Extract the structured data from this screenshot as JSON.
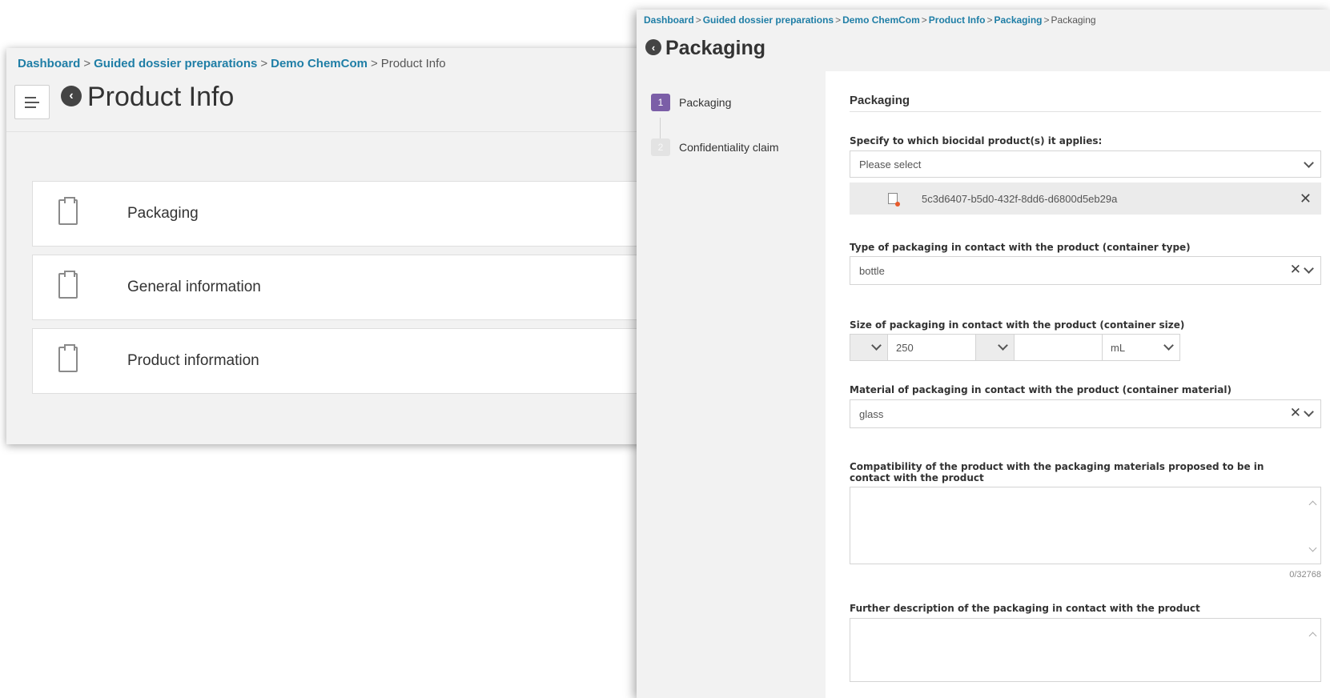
{
  "left_window": {
    "breadcrumb": [
      "Dashboard",
      "Guided dossier preparations",
      "Demo ChemCom",
      "Product Info"
    ],
    "separator": ">",
    "title": "Product Info",
    "cards": [
      {
        "label": "Packaging"
      },
      {
        "label": "General information"
      },
      {
        "label": "Product information"
      }
    ]
  },
  "right_window": {
    "breadcrumb": [
      "Dashboard",
      "Guided dossier preparations",
      "Demo ChemCom",
      "Product Info",
      "Packaging",
      "Packaging"
    ],
    "title": "Packaging",
    "steps": [
      {
        "number": "1",
        "label": "Packaging",
        "active": true
      },
      {
        "number": "2",
        "label": "Confidentiality claim",
        "active": false
      }
    ],
    "form": {
      "section_title": "Packaging",
      "biocidal_label": "Specify to which biocidal product(s) it applies:",
      "biocidal_placeholder": "Please select",
      "selected_product_id": "5c3d6407-b5d0-432f-8dd6-d6800d5eb29a",
      "container_type_label": "Type of packaging in contact with the product (container type)",
      "container_type_value": "bottle",
      "container_size_label": "Size of packaging in contact with the product (container size)",
      "container_size_value": "250",
      "container_size_upper": "",
      "container_size_unit": "mL",
      "container_material_label": "Material of packaging in contact with the product (container material)",
      "container_material_value": "glass",
      "compatibility_label": "Compatibility of the product with the packaging materials proposed to be in contact with the product",
      "compatibility_counter": "0/32768",
      "further_description_label": "Further description of the packaging in contact with the product"
    }
  },
  "colors": {
    "link": "#1f7ea6",
    "step_active": "#7b5ea7",
    "step_inactive": "#e0e0e0",
    "panel_bg": "#f2f2f2"
  },
  "icons": {
    "back": "back-circle-icon",
    "menu": "menu-icon",
    "card": "clipboard-icon",
    "doc": "document-icon",
    "clear": "close-icon",
    "dropdown": "chevron-down-icon"
  }
}
